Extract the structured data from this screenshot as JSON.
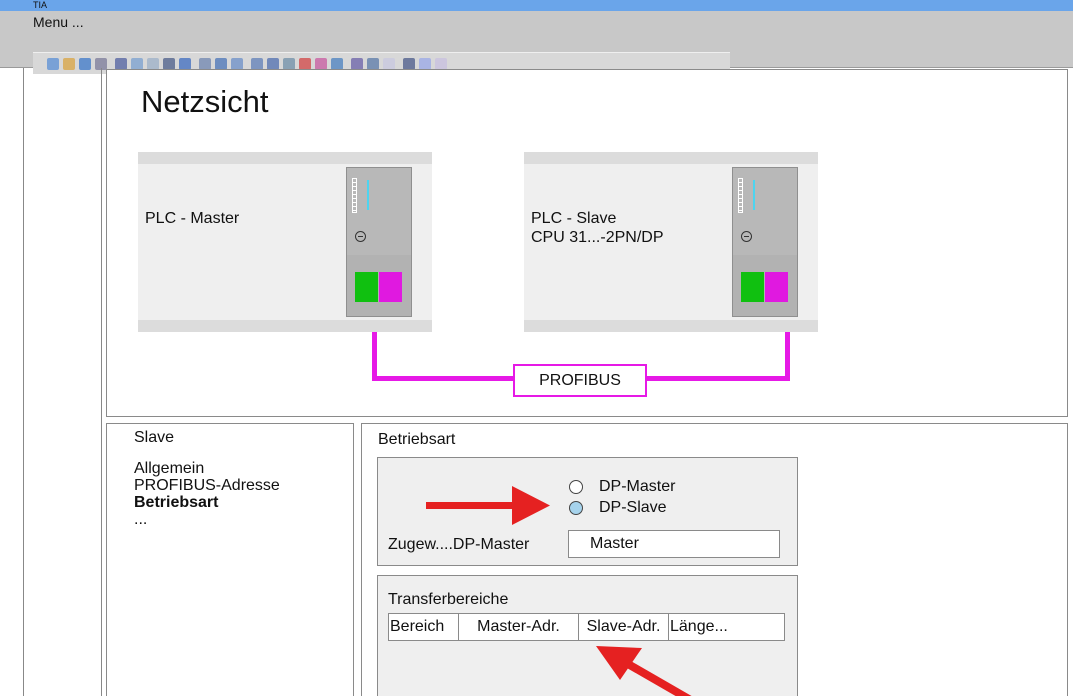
{
  "window": {
    "title": "TIA"
  },
  "menubar": {
    "label": "Menu ..."
  },
  "toolbar": {
    "icons": [
      "new-icon",
      "open-icon",
      "save-icon",
      "print-icon",
      "cut-icon",
      "copy-icon",
      "paste-icon",
      "delete-icon",
      "undo-icon",
      "redo-icon",
      "compile-icon",
      "download-icon",
      "upload-icon",
      "online-icon",
      "offline-icon",
      "monitor-icon",
      "stop-icon",
      "run-icon",
      "chart-icon",
      "compare-icon",
      "diagnose-icon",
      "close-icon",
      "split-icon",
      "window-icon"
    ]
  },
  "network_view": {
    "title": "Netzsicht",
    "master": {
      "name": "PLC - Master"
    },
    "slave": {
      "name": "PLC - Slave\nCPU 31...-2PN/DP"
    },
    "bus_label": "PROFIBUS"
  },
  "colors": {
    "bus": "#e619e6",
    "port_green": "#10c010",
    "port_magenta": "#e019e0",
    "arrow": "#e52121",
    "title_bar": "#6aa5ea"
  },
  "slave_panel": {
    "title": "Slave",
    "items": [
      {
        "label": "Allgemein",
        "active": false
      },
      {
        "label": "PROFIBUS-Adresse",
        "active": false
      },
      {
        "label": "Betriebsart",
        "active": true
      },
      {
        "label": "...",
        "active": false
      }
    ]
  },
  "operating_mode": {
    "title": "Betriebsart",
    "options": [
      {
        "label": "DP-Master",
        "selected": false
      },
      {
        "label": "DP-Slave",
        "selected": true
      }
    ],
    "assigned_master_label": "Zugew....DP-Master",
    "assigned_master_value": "Master"
  },
  "transfer_areas": {
    "title": "Transferbereiche",
    "columns": [
      "Bereich",
      "Master-Adr.",
      "Slave-Adr.",
      "Länge..."
    ]
  }
}
